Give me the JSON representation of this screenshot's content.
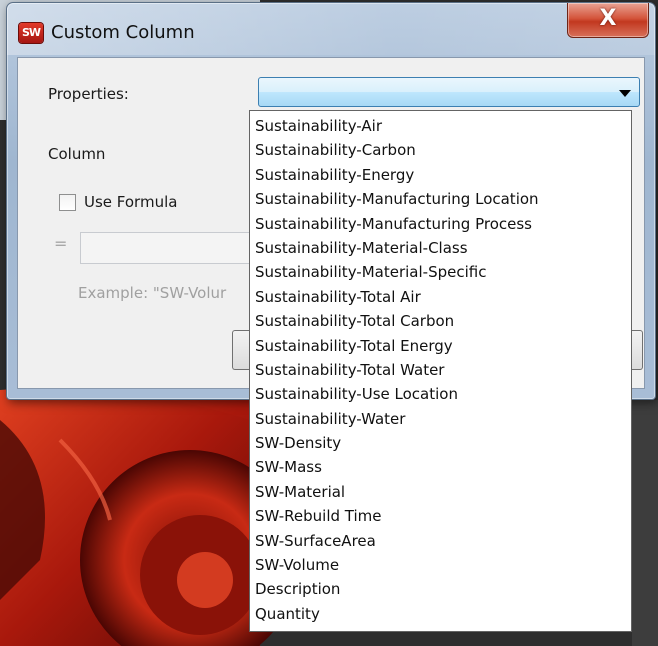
{
  "window": {
    "title": "Custom Column",
    "app_icon": "SW",
    "close_label": "X"
  },
  "form": {
    "properties_label": "Properties:",
    "properties_value": "",
    "column_label": "Column",
    "use_formula_label": "Use Formula",
    "use_formula_checked": false,
    "equals_sign": "=",
    "formula_value": "",
    "example_text": "Example: \"SW-Volur"
  },
  "dropdown": {
    "options": [
      "Sustainability-Air",
      "Sustainability-Carbon",
      "Sustainability-Energy",
      "Sustainability-Manufacturing Location",
      "Sustainability-Manufacturing Process",
      "Sustainability-Material-Class",
      "Sustainability-Material-Specific",
      "Sustainability-Total Air",
      "Sustainability-Total Carbon",
      "Sustainability-Total Energy",
      "Sustainability-Total Water",
      "Sustainability-Use Location",
      "Sustainability-Water",
      "SW-Density",
      "SW-Mass",
      "SW-Material",
      "SW-Rebuild Time",
      "SW-SurfaceArea",
      "SW-Volume",
      "Description",
      "Quantity"
    ]
  },
  "colors": {
    "accent": "#3c7fb1",
    "close_button": "#c2381f",
    "model_red": "#c02010"
  },
  "icons": {
    "app": "solidworks-icon",
    "close": "close-icon",
    "dropdown": "chevron-down-icon"
  }
}
